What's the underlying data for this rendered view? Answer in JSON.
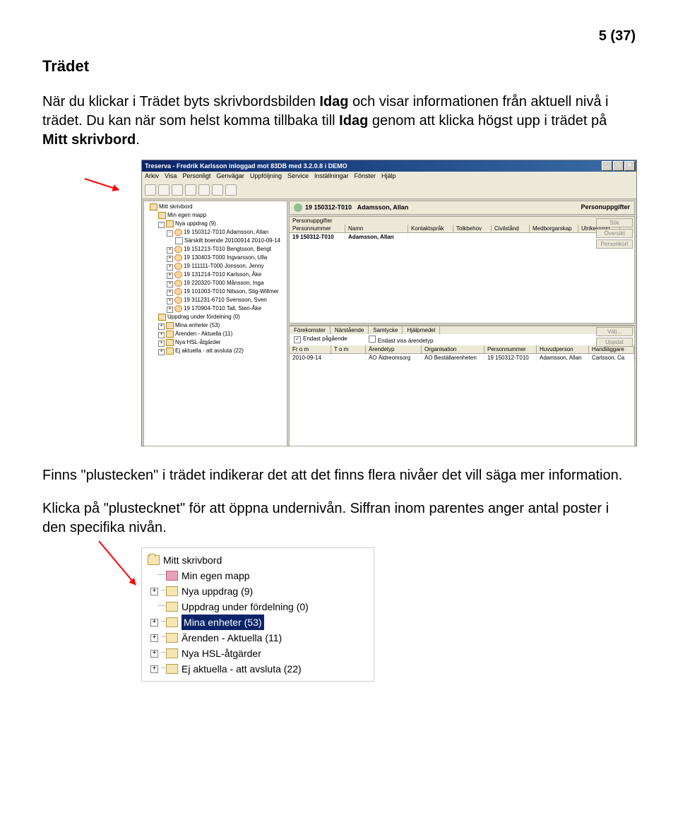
{
  "page_number": "5 (37)",
  "section_title": "Trädet",
  "para1_pre": "När du klickar i Trädet byts skrivbordsbilden ",
  "para1_bold1": "Idag",
  "para1_mid": " och visar informationen från aktuell nivå i trädet. Du kan när som helst komma tillbaka till ",
  "para1_bold2": "Idag",
  "para1_mid2": " genom att klicka högst upp i trädet på ",
  "para1_bold3": "Mitt skrivbord",
  "para1_end": ".",
  "para2": "Finns \"plustecken\" i trädet indikerar det att det finns flera nivåer det vill säga mer information.",
  "para3": "Klicka på \"plustecknet\" för att öppna undernivån. Siffran inom parentes anger antal poster i den specifika nivån.",
  "app": {
    "title": "Treserva - Fredrik Karlsson inloggad mot 83DB med 3.2.0.8 i DEMO",
    "menu": [
      "Arkiv",
      "Visa",
      "Personligt",
      "Genvägar",
      "Uppföljning",
      "Service",
      "Inställningar",
      "Fönster",
      "Hjälp"
    ],
    "header_id": "19 150312-T010",
    "header_name": "Adamsson, Allan",
    "header_section": "Personuppgifter",
    "tree": {
      "root": "Mitt skrivbord",
      "items": [
        "Min egen mapp",
        "Nya uppdrag (9)",
        "19 150312-T010  Adamsson, Allan",
        "Särskilt boende 20100914 2010-09-14",
        "19 151213-T010 Bengtsson, Bengt",
        "19 130403-T000 Ingvarsson, Ulla",
        "19 111111-T000 Jonsson, Jenny",
        "19 131214-T010 Karlsson, Åke",
        "19 220320-T000 Månsson, Inga",
        "19 101003-T010 Nilsson, Stig-Willmer",
        "19 311231-6710 Svensson, Sven",
        "19 170904-T010 Tall, Sten-Åke",
        "Uppdrag under fördelning (0)",
        "Mina enheter (53)",
        "Ärenden - Aktuella (11)",
        "Nya HSL-åtgärder",
        "Ej aktuella - att avsluta (22)"
      ]
    },
    "grid1": {
      "title": "Personuppgifter",
      "headers": [
        "Personnummer",
        "Namn",
        "Kontaktspråk",
        "Tolkbehov",
        "Civilstånd",
        "Medborgarskap",
        "Utrikesfödd"
      ],
      "row": [
        "19 150312-T010",
        "Adamsson, Allan",
        "",
        "",
        "",
        "",
        ""
      ],
      "buttons": [
        "Sök",
        "Översikt",
        "Personkort"
      ]
    },
    "tabs": [
      "Förekomster",
      "Närstående",
      "Samtycke",
      "Hjälpmedel"
    ],
    "check1": "Endast pågående",
    "check2": "Endast viss ärendetyp",
    "grid2": {
      "headers": [
        "Fr o m",
        "T o m",
        "Ärendetyp",
        "Organisation",
        "Personnummer",
        "Huvudperson",
        "Handläggare"
      ],
      "row": [
        "2010-09-14",
        "",
        "ÄO Äldreomsorg",
        "ÄO Beställarenheten",
        "19 150312-T010",
        "Adamsson, Allan",
        "Carlsson, Ca"
      ],
      "buttons": [
        "Välj...",
        "Uppdat"
      ]
    }
  },
  "tree2": {
    "root": "Mitt skrivbord",
    "items": [
      {
        "plus": false,
        "label": "Min egen mapp",
        "pink": true
      },
      {
        "plus": true,
        "label": "Nya uppdrag (9)"
      },
      {
        "plus": false,
        "label": "Uppdrag under fördelning (0)"
      },
      {
        "plus": true,
        "label": "Mina enheter (53)",
        "selected": true
      },
      {
        "plus": true,
        "label": "Ärenden - Aktuella (11)"
      },
      {
        "plus": true,
        "label": "Nya HSL-åtgärder"
      },
      {
        "plus": true,
        "label": "Ej aktuella - att avsluta (22)"
      }
    ]
  }
}
